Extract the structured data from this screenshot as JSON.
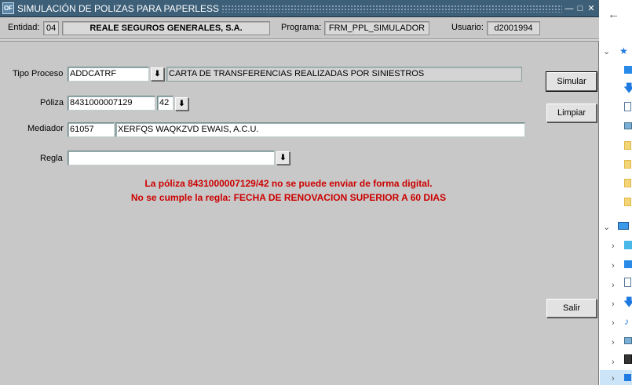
{
  "window": {
    "title": "SIMULACIÓN DE POLIZAS PARA PAPERLESS",
    "app_icon": "oracle-forms-icon",
    "controls": [
      "minimize-icon",
      "maximize-icon",
      "close-icon"
    ]
  },
  "header": {
    "entidad_label": "Entidad:",
    "entidad_code": "04",
    "entidad_name": "REALE SEGUROS GENERALES, S.A.",
    "programa_label": "Programa:",
    "programa_value": "FRM_PPL_SIMULADOR",
    "usuario_label": "Usuario:",
    "usuario_value": "d2001994"
  },
  "form": {
    "tipo_proceso_label": "Tipo Proceso",
    "tipo_proceso_code": "ADDCATRF",
    "tipo_proceso_desc": "CARTA DE TRANSFERENCIAS REALIZADAS POR SINIESTROS",
    "poliza_label": "Póliza",
    "poliza_number": "8431000007129",
    "poliza_suffix": "42",
    "mediador_label": "Mediador",
    "mediador_code": "61057",
    "mediador_name": "XERFQS WAQKZVD EWAIS, A.C.U.",
    "regla_label": "Regla",
    "regla_value": ""
  },
  "messages": {
    "line1": "La póliza 8431000007129/42 no se puede enviar de forma digital.",
    "line2": "No se cumple la regla: FECHA DE RENOVACION SUPERIOR A 60 DIAS",
    "color": "#cc0000"
  },
  "buttons": {
    "simular": "Simular",
    "limpiar": "Limpiar",
    "salir": "Salir"
  },
  "colors": {
    "titlebar": "#3d5f78",
    "window_bg": "#c8c8c8"
  },
  "explorer_pane": {
    "back_icon": "back-arrow-icon",
    "items": [
      "quick-access-icon",
      "desktop-icon",
      "downloads-icon",
      "documents-icon",
      "pictures-icon",
      "folder-icon",
      "folder-icon",
      "folder-icon",
      "folder-icon",
      "this-pc-icon",
      "3d-objects-icon",
      "desktop-icon",
      "documents-icon",
      "downloads-icon",
      "music-icon",
      "pictures-icon",
      "videos-icon",
      "local-disk-icon"
    ]
  }
}
